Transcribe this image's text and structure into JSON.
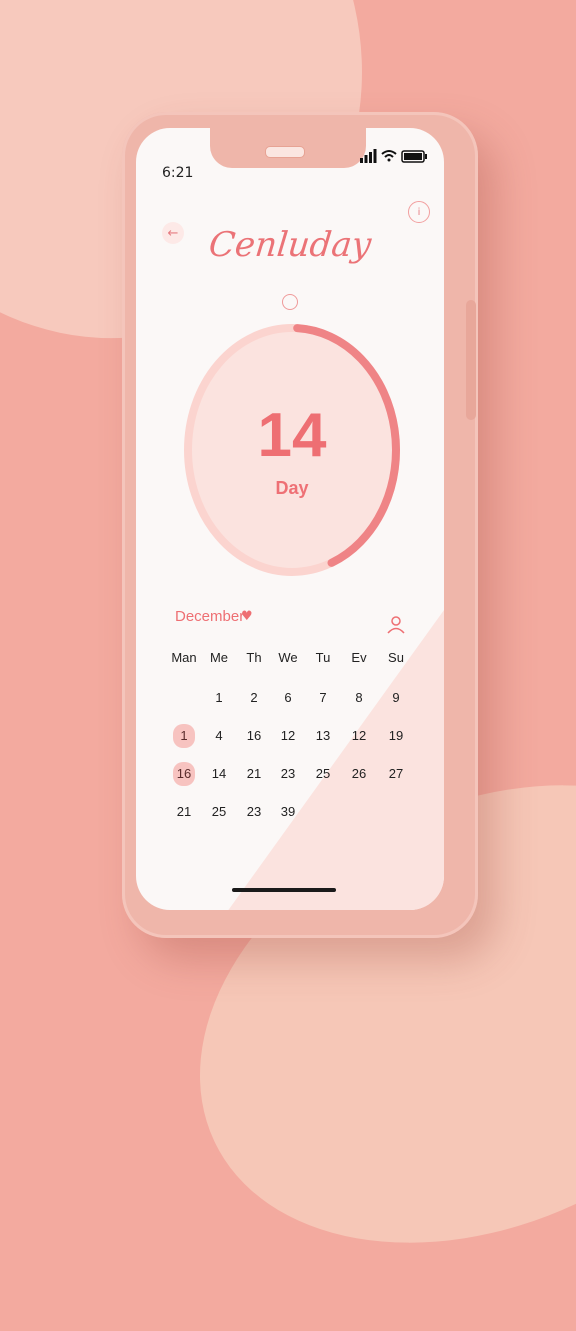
{
  "status_bar": {
    "time": "6:21"
  },
  "header": {
    "title": "Cenluday",
    "back_icon": "arrow-left-icon",
    "action_icon": "info-icon"
  },
  "counter": {
    "value": "14",
    "label": "Day",
    "progress": 0.43
  },
  "calendar": {
    "month": "December",
    "weekdays": [
      "Man",
      "Me",
      "Th",
      "We",
      "Tu",
      "Ev",
      "Su"
    ],
    "rows": [
      [
        "",
        "1",
        "2",
        "6",
        "7",
        "8",
        "9"
      ],
      [
        "1",
        "4",
        "16",
        "12",
        "13",
        "12",
        "19"
      ],
      [
        "16",
        "14",
        "21",
        "23",
        "25",
        "26",
        "27"
      ],
      [
        "21",
        "25",
        "23",
        "39",
        "",
        "",
        ""
      ]
    ],
    "highlighted": [
      "1",
      "16"
    ]
  },
  "colors": {
    "accent": "#ee6f73",
    "ring_track": "#fbe3df",
    "ring_fill": "#ef8486",
    "background": "#f3aa9f"
  }
}
